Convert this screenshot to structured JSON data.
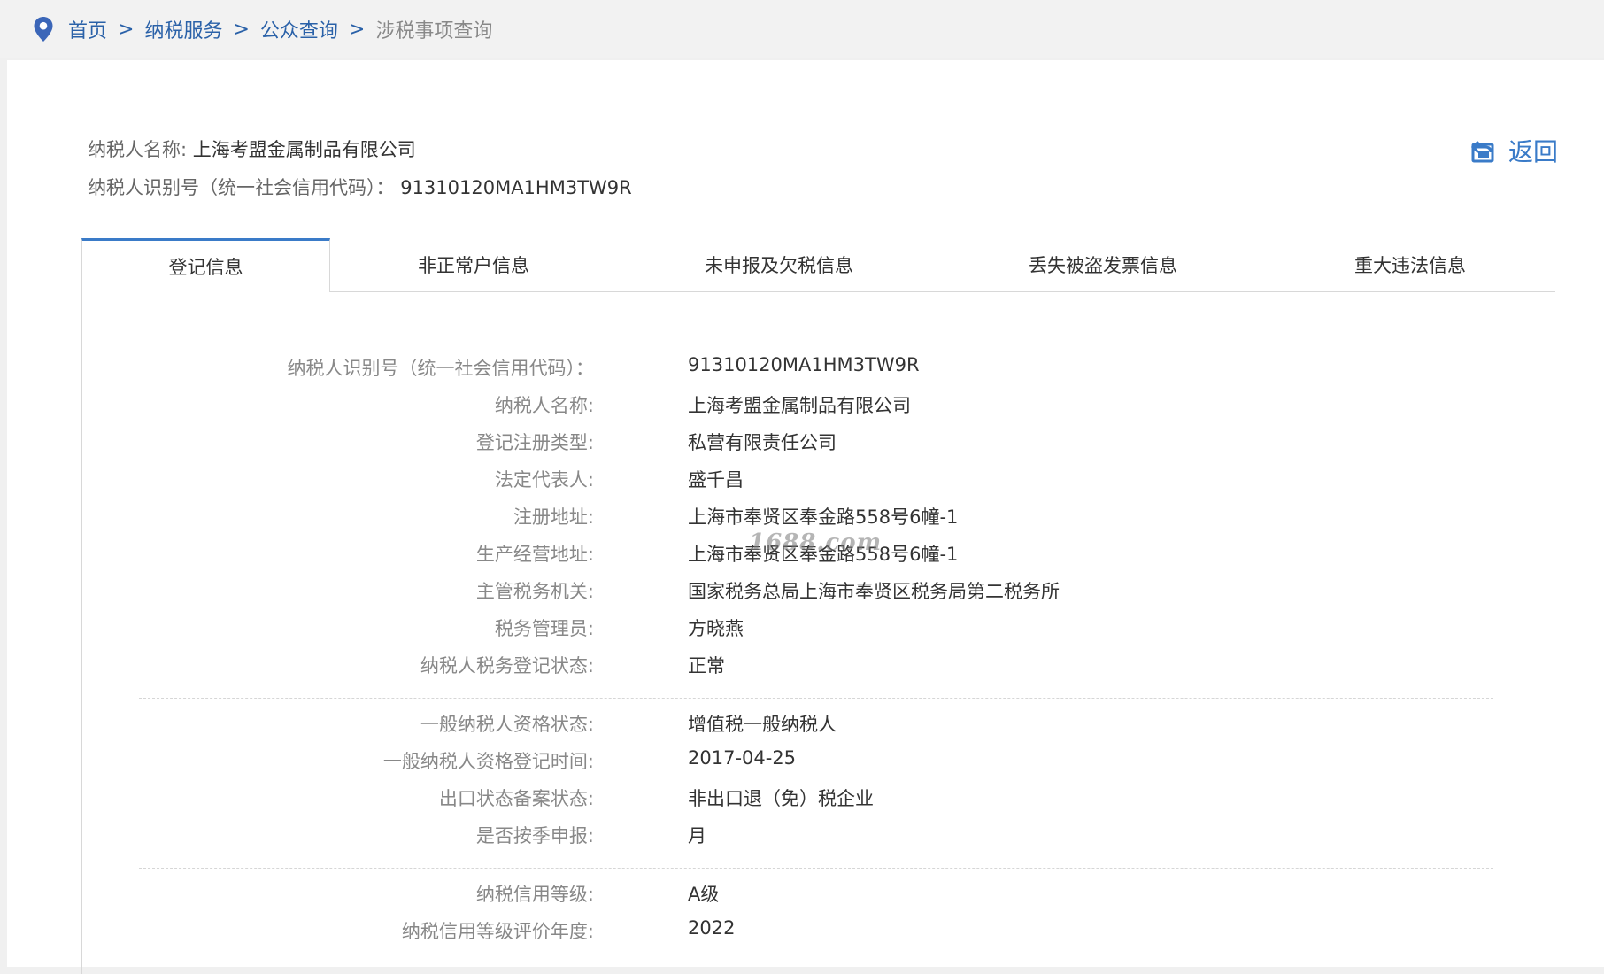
{
  "breadcrumb": {
    "items": [
      "首页",
      "纳税服务",
      "公众查询"
    ],
    "separator": ">",
    "current": "涉税事项查询"
  },
  "header": {
    "name_label": "纳税人名称:",
    "name_value": "上海考盟金属制品有限公司",
    "id_label": "纳税人识别号（统一社会信用代码）：",
    "id_value": "91310120MA1HM3TW9R",
    "return_label": "返回"
  },
  "tabs": [
    {
      "label": "登记信息",
      "active": true
    },
    {
      "label": "非正常户信息",
      "active": false
    },
    {
      "label": "未申报及欠税信息",
      "active": false
    },
    {
      "label": "丢失被盗发票信息",
      "active": false
    },
    {
      "label": "重大违法信息",
      "active": false
    }
  ],
  "details": {
    "group1": [
      {
        "label": "纳税人识别号（统一社会信用代码）：",
        "value": "91310120MA1HM3TW9R"
      },
      {
        "label": "纳税人名称:",
        "value": "上海考盟金属制品有限公司"
      },
      {
        "label": "登记注册类型:",
        "value": "私营有限责任公司"
      },
      {
        "label": "法定代表人:",
        "value": "盛千昌"
      },
      {
        "label": "注册地址:",
        "value": "上海市奉贤区奉金路558号6幢-1"
      },
      {
        "label": "生产经营地址:",
        "value": "上海市奉贤区奉金路558号6幢-1"
      },
      {
        "label": "主管税务机关:",
        "value": "国家税务总局上海市奉贤区税务局第二税务所"
      },
      {
        "label": "税务管理员:",
        "value": "方晓燕"
      },
      {
        "label": "纳税人税务登记状态:",
        "value": "正常"
      }
    ],
    "group2": [
      {
        "label": "一般纳税人资格状态:",
        "value": "增值税一般纳税人"
      },
      {
        "label": "一般纳税人资格登记时间:",
        "value": "2017-04-25"
      },
      {
        "label": "出口状态备案状态:",
        "value": "非出口退（免）税企业"
      },
      {
        "label": "是否按季申报:",
        "value": "月"
      }
    ],
    "group3": [
      {
        "label": "纳税信用等级:",
        "value": "A级"
      },
      {
        "label": "纳税信用等级评价年度:",
        "value": "2022"
      }
    ]
  },
  "watermark": "1688.com",
  "colors": {
    "link": "#2a61a8",
    "accent": "#3a7bc8",
    "label": "#888888",
    "text": "#333333"
  },
  "icons": {
    "breadcrumb": "location-pin-icon",
    "return": "return-arrow-icon"
  }
}
